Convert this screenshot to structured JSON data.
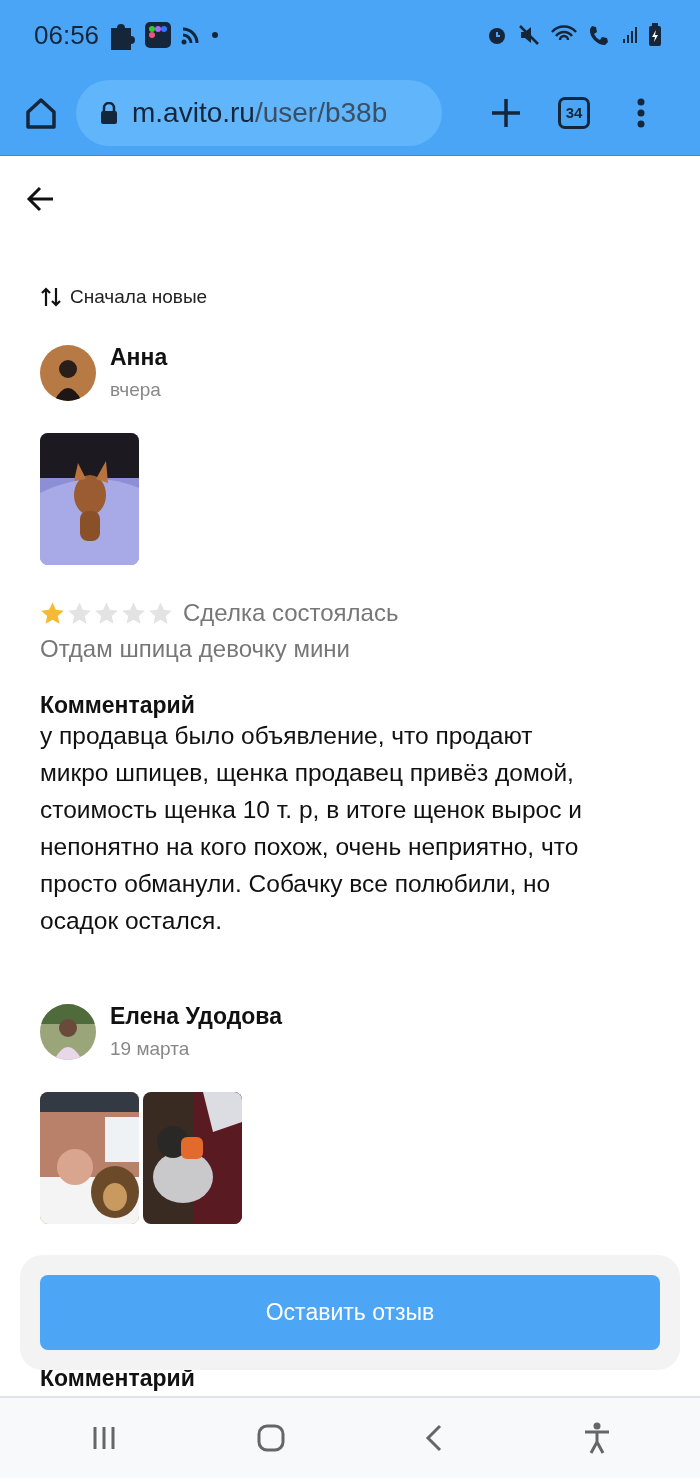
{
  "status_bar": {
    "time": "06:56"
  },
  "browser": {
    "url_host": "m.avito.ru",
    "url_path": "/user/b38b",
    "tab_count": "34"
  },
  "sort": {
    "label": "Сначала новые"
  },
  "reviews": [
    {
      "author": "Анна",
      "date": "вчера",
      "photos": [
        {
          "kind": "picture"
        }
      ],
      "stars": 1,
      "deal_status": "Сделка состоялась",
      "item_title": "Отдам шпица девочку мини",
      "comment_heading": "Комментарий",
      "comment": "у продавца было объявление, что продают микро шпицев, щенка продавец привёз домой, стоимость щенка 10 т. р, в итоге щенок вырос и непонятно на кого похож, очень неприятно, что просто обманули. Собачку все полюбили, но осадок остался."
    },
    {
      "author": "Елена Удодова",
      "date": "19 марта",
      "photos": [
        {
          "kind": "picture"
        },
        {
          "kind": "picture"
        }
      ],
      "comment_heading": "Комментарий"
    }
  ],
  "action_button": {
    "label": "Оставить отзыв"
  }
}
